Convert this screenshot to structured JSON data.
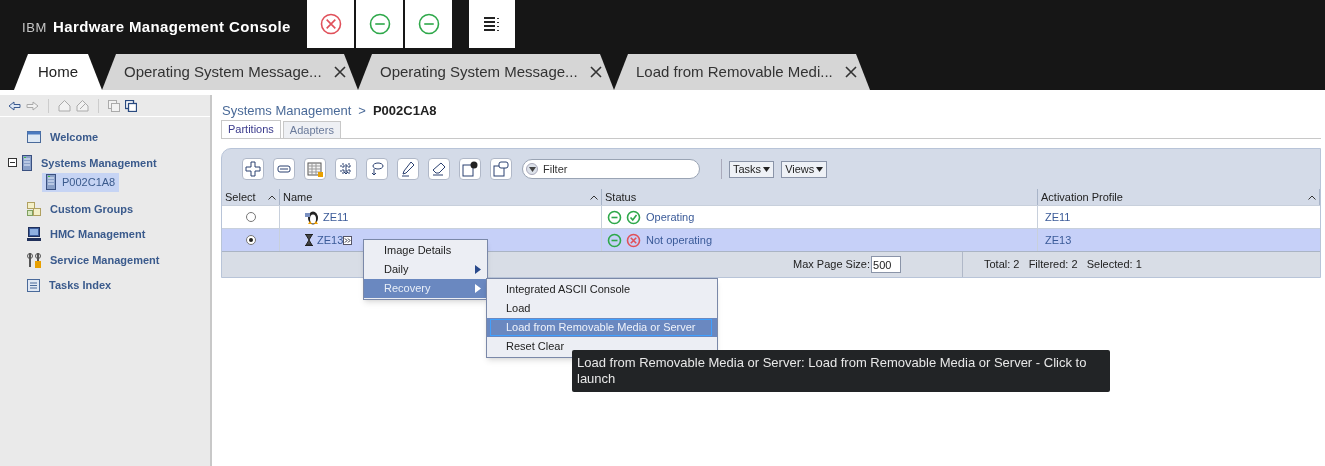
{
  "header": {
    "brand": "IBM",
    "title": "Hardware Management Console",
    "status_buttons": [
      {
        "kind": "error"
      },
      {
        "kind": "minus"
      },
      {
        "kind": "minus"
      }
    ]
  },
  "tabs": [
    {
      "label": "Home",
      "selected": true,
      "closable": false
    },
    {
      "label": "Operating System Message...",
      "selected": false,
      "closable": true
    },
    {
      "label": "Operating System Message...",
      "selected": false,
      "closable": true
    },
    {
      "label": "Load from Removable Medi...",
      "selected": false,
      "closable": true
    }
  ],
  "sidebar": {
    "items": [
      {
        "label": "Welcome"
      },
      {
        "label": "Systems Management",
        "expanded": true,
        "children": [
          {
            "label": "P002C1A8",
            "selected": true
          }
        ]
      },
      {
        "label": "Custom Groups"
      },
      {
        "label": "HMC Management"
      },
      {
        "label": "Service Management"
      },
      {
        "label": "Tasks Index"
      }
    ]
  },
  "breadcrumb": {
    "parent": "Systems Management",
    "separator": ">",
    "current": "P002C1A8"
  },
  "subtabs": [
    {
      "label": "Partitions",
      "selected": true
    },
    {
      "label": "Adapters",
      "selected": false
    }
  ],
  "toolbar": {
    "filter_placeholder": "Filter",
    "menus": [
      "Tasks",
      "Views"
    ]
  },
  "table": {
    "columns": [
      "Select",
      "Name",
      "Status",
      "Activation Profile"
    ],
    "rows": [
      {
        "selected": false,
        "name": "ZE11",
        "operating": true,
        "status": "Operating",
        "profile": "ZE11"
      },
      {
        "selected": true,
        "name": "ZE13",
        "operating": false,
        "status": "Not operating",
        "profile": "ZE13"
      }
    ],
    "footer": {
      "page_size_label": "Max Page Size:",
      "page_size": "500",
      "summary": "Total: 2   Filtered: 2   Selected: 1"
    }
  },
  "context_menu": [
    {
      "label": "Image Details",
      "submenu": false,
      "highlighted": false
    },
    {
      "label": "Daily",
      "submenu": true,
      "highlighted": false
    },
    {
      "label": "Recovery",
      "submenu": true,
      "highlighted": true
    }
  ],
  "submenu": [
    {
      "label": "Integrated ASCII Console",
      "highlighted": false
    },
    {
      "label": "Load",
      "highlighted": false
    },
    {
      "label": "Load from Removable Media or Server",
      "highlighted": true
    },
    {
      "label": "Reset Clear",
      "highlighted": false
    }
  ],
  "tooltip": "Load from Removable Media or Server: Load from Removable Media or Server - Click to launch"
}
